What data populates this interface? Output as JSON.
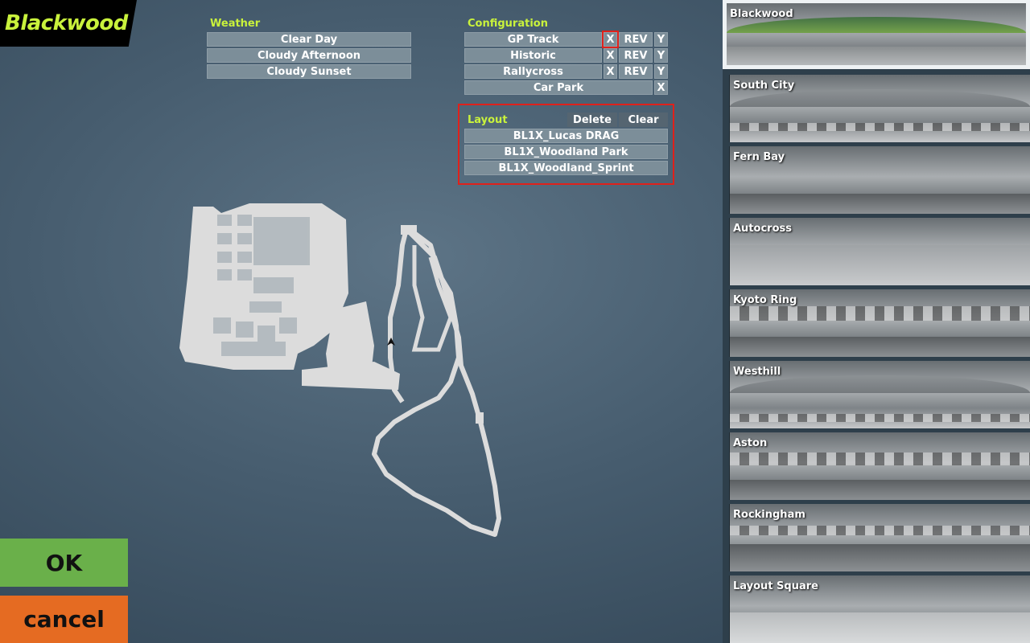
{
  "track_title": "Blackwood",
  "weather": {
    "label": "Weather",
    "options": [
      "Clear Day",
      "Cloudy Afternoon",
      "Cloudy Sunset"
    ]
  },
  "configuration": {
    "label": "Configuration",
    "rows": [
      {
        "name": "GP Track",
        "x": "X",
        "rev": "REV",
        "y": "Y"
      },
      {
        "name": "Historic",
        "x": "X",
        "rev": "REV",
        "y": "Y"
      },
      {
        "name": "Rallycross",
        "x": "X",
        "rev": "REV",
        "y": "Y"
      },
      {
        "name": "Car Park",
        "x": "X"
      }
    ]
  },
  "layout": {
    "label": "Layout",
    "delete_label": "Delete",
    "clear_label": "Clear",
    "items": [
      "BL1X_Lucas DRAG",
      "BL1X_Woodland Park",
      "BL1X_Woodland_Sprint"
    ]
  },
  "buttons": {
    "ok": "OK",
    "cancel": "cancel"
  },
  "tracks": [
    "Blackwood",
    "South City",
    "Fern Bay",
    "Autocross",
    "Kyoto Ring",
    "Westhill",
    "Aston",
    "Rockingham",
    "Layout Square"
  ],
  "selected_track": "Blackwood",
  "colors": {
    "accent": "#c9f23c",
    "ok": "#6ab04a",
    "cancel": "#e56b22",
    "highlight": "#e0211b"
  },
  "icons": {
    "map_marker": "arrow-marker-icon"
  }
}
